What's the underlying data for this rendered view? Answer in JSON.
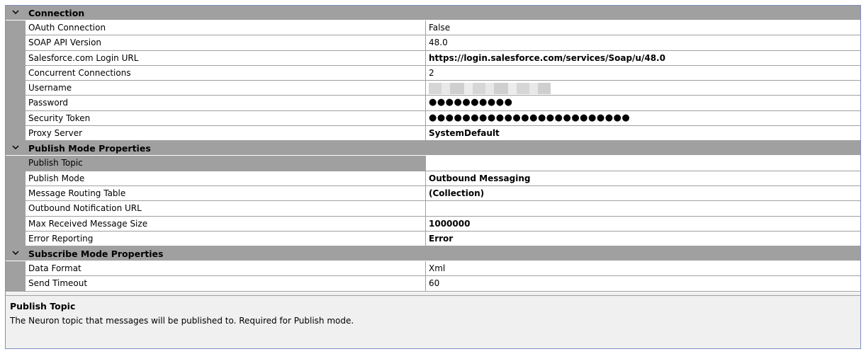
{
  "categories": [
    {
      "label": "Connection",
      "properties": [
        {
          "name": "OAuth Connection",
          "value": "False",
          "bold": false
        },
        {
          "name": "SOAP API Version",
          "value": "48.0",
          "bold": false
        },
        {
          "name": "Salesforce.com Login URL",
          "value": "https://login.salesforce.com/services/Soap/u/48.0",
          "bold": true
        },
        {
          "name": "Concurrent Connections",
          "value": "2",
          "bold": false
        },
        {
          "name": "Username",
          "value": "",
          "bold": false,
          "redacted": true
        },
        {
          "name": "Password",
          "value": "●●●●●●●●●●",
          "bold": false,
          "masked": true
        },
        {
          "name": "Security Token",
          "value": "●●●●●●●●●●●●●●●●●●●●●●●●",
          "bold": false,
          "masked": true
        },
        {
          "name": "Proxy Server",
          "value": "SystemDefault",
          "bold": true
        }
      ]
    },
    {
      "label": "Publish Mode Properties",
      "properties": [
        {
          "name": "Publish Topic",
          "value": "",
          "bold": false,
          "selected": true
        },
        {
          "name": "Publish Mode",
          "value": "Outbound Messaging",
          "bold": true
        },
        {
          "name": "Message Routing Table",
          "value": "(Collection)",
          "bold": true
        },
        {
          "name": "Outbound Notification URL",
          "value": "",
          "bold": false
        },
        {
          "name": "Max Received Message Size",
          "value": "1000000",
          "bold": true
        },
        {
          "name": "Error Reporting",
          "value": "Error",
          "bold": true
        }
      ]
    },
    {
      "label": "Subscribe Mode Properties",
      "properties": [
        {
          "name": "Data Format",
          "value": "Xml",
          "bold": false
        },
        {
          "name": "Send Timeout",
          "value": "60",
          "bold": false
        }
      ]
    }
  ],
  "description": {
    "title": "Publish Topic",
    "text": "The Neuron topic that messages will be published to. Required for Publish mode."
  },
  "colors": {
    "category_bg": "#a0a0a0",
    "grid_line": "#a0a0a0",
    "frame_border": "#7f8ec2",
    "description_bg": "#f0f0f0"
  },
  "icons": {
    "category_toggle": "chevron-down-icon"
  }
}
